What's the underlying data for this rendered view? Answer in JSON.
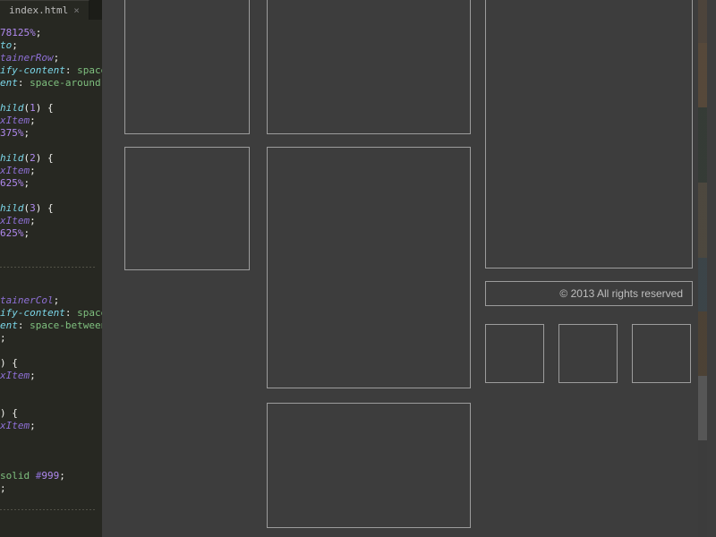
{
  "editor": {
    "tab_label": "index.html",
    "code_lines": [
      "78125%;",
      "to;",
      "tainerRow;",
      "ify-content: space-aroun",
      "ent: space-around;",
      "",
      "hild(1) {",
      "xItem;",
      "375%;",
      "",
      "hild(2) {",
      "xItem;",
      "625%;",
      "",
      "hild(3) {",
      "xItem;",
      "625%;",
      "",
      "",
      "__SEP__",
      "",
      "",
      "tainerCol;",
      "ify-content: space-betwe",
      "ent: space-between;",
      ";",
      "",
      ") {",
      "xItem;",
      "",
      "",
      ") {",
      "xItem;",
      "",
      "",
      "",
      "solid #999;",
      ";",
      "",
      "__SEP__",
      ""
    ]
  },
  "preview": {
    "footer_text": "© 2013 All rights reserved"
  }
}
